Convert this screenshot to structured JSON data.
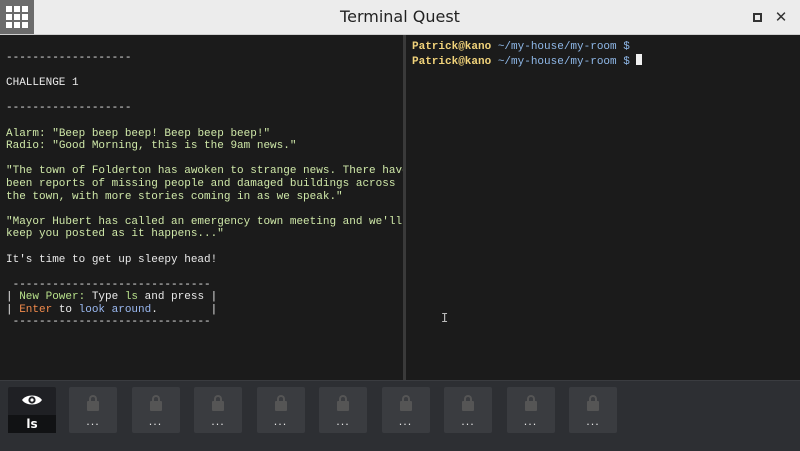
{
  "window": {
    "title": "Terminal Quest",
    "maximize_icon": "maximize-icon",
    "close_label": "✕"
  },
  "story": {
    "separator_top": "-------------------",
    "challenge": "CHALLENGE 1",
    "separator_mid": "-------------------",
    "alarm_speaker": "Alarm",
    "alarm_line": ": \"Beep beep beep! Beep beep beep!\"",
    "radio_speaker": "Radio",
    "radio_line": ": \"Good Morning, this is the 9am news.\"",
    "para1_line1": "\"The town of Folderton has awoken to strange news. There have",
    "para1_line2": "been reports of missing people and damaged buildings across",
    "para1_line3": "the town, with more stories coming in as we speak.\"",
    "para2_line1": "\"Mayor Hubert has called an emergency town meeting and we'll",
    "para2_line2": "keep you posted as it happens...\"",
    "wake_line": "It's time to get up sleepy head!",
    "box_border": "------------------------------",
    "power_label": "New Power:",
    "power_text_a": " Type ",
    "power_cmd": "ls",
    "power_text_b": " and press ",
    "enter_label": "Enter",
    "to_text": " to ",
    "look_text": "look around",
    "period": "."
  },
  "shell": {
    "lines": [
      {
        "user": "Patrick@kano",
        "path": " ~/my-house/my-room",
        "symbol": " $"
      },
      {
        "user": "Patrick@kano",
        "path": " ~/my-house/my-room",
        "symbol": " $ "
      }
    ],
    "ibeam": "I"
  },
  "toolbar": {
    "active_tool": {
      "label": "ls",
      "icon": "eye-icon"
    },
    "locked_label": "...",
    "locked_count": 9,
    "locked_icon": "lock-icon"
  },
  "colors": {
    "bg": "#1b1b1b",
    "prompt_user": "#f0d27a",
    "prompt_path": "#8fb8e8",
    "power": "#b7e08a",
    "enter": "#f08a4b",
    "look": "#9ab8f0"
  }
}
